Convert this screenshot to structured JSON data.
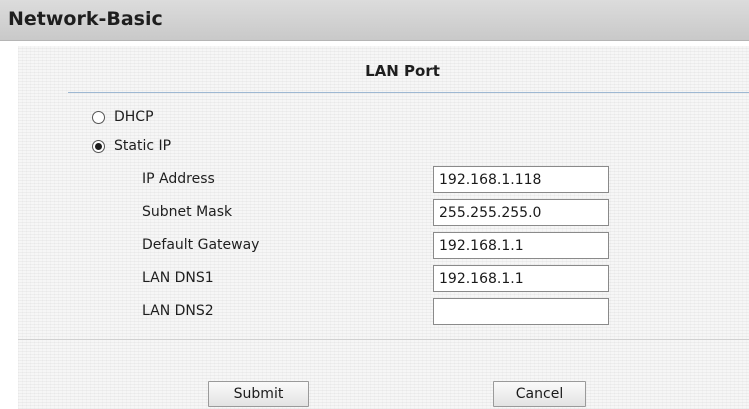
{
  "header": {
    "title": "Network-Basic"
  },
  "section": {
    "title": "LAN Port"
  },
  "mode": {
    "options": [
      {
        "label": "DHCP",
        "checked": false
      },
      {
        "label": "Static IP",
        "checked": true
      }
    ]
  },
  "fields": [
    {
      "label": "IP Address",
      "value": "192.168.1.118"
    },
    {
      "label": "Subnet Mask",
      "value": "255.255.255.0"
    },
    {
      "label": "Default Gateway",
      "value": "192.168.1.1"
    },
    {
      "label": "LAN DNS1",
      "value": "192.168.1.1"
    },
    {
      "label": "LAN DNS2",
      "value": ""
    }
  ],
  "buttons": {
    "submit": "Submit",
    "cancel": "Cancel"
  }
}
